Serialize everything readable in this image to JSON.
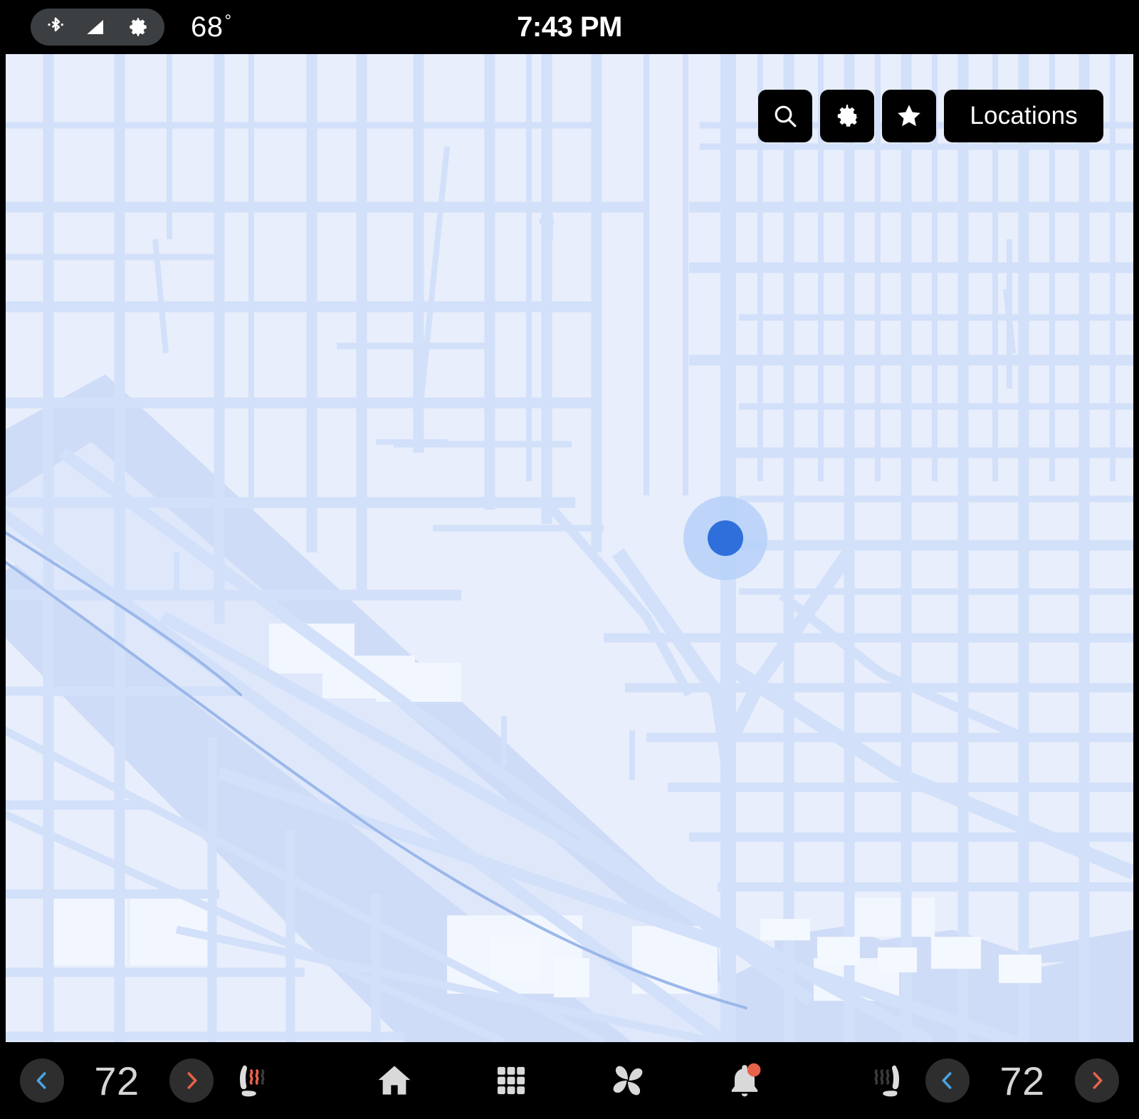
{
  "status_bar": {
    "icons": [
      {
        "name": "bluetooth-icon",
        "label": "Bluetooth"
      },
      {
        "name": "signal-icon",
        "label": "Cellular signal"
      },
      {
        "name": "gear-icon",
        "label": "Settings"
      }
    ],
    "outside_temperature": "68",
    "degree_symbol": "°",
    "clock": "7:43 PM",
    "pill_color": "#3c3f41",
    "text_color": "#ffffff"
  },
  "map": {
    "background_color": "#e8eefb",
    "road_color": "#d2e0fa",
    "water_color": "#cfdcf7",
    "river_line_color": "#9bb8ea",
    "building_color": "#f2f6fe",
    "marker": {
      "name": "current-location-marker",
      "dot_color": "#2f6fdb",
      "halo_color": "#b6d0f8"
    }
  },
  "map_controls": {
    "background_color": "#000000",
    "buttons": [
      {
        "name": "search-button",
        "icon": "search-icon",
        "label": ""
      },
      {
        "name": "settings-button",
        "icon": "gear-icon",
        "label": ""
      },
      {
        "name": "favorites-button",
        "icon": "star-icon",
        "label": ""
      },
      {
        "name": "locations-button",
        "icon": "",
        "label": "Locations"
      }
    ]
  },
  "nav_bar": {
    "background_color": "#000000",
    "climate_left": {
      "decrease_label": "‹",
      "temperature": "72",
      "increase_label": "›",
      "decrease_color": "#4ba3e3",
      "increase_color": "#e8624a",
      "value_color": "#d5d5d5"
    },
    "climate_right": {
      "decrease_label": "‹",
      "temperature": "72",
      "increase_label": "›",
      "decrease_color": "#4ba3e3",
      "increase_color": "#e8624a",
      "value_color": "#d5d5d5"
    },
    "seat_left": {
      "name": "driver-seat-heater-button",
      "icon": "heated-seat-icon",
      "active_waves": 2,
      "total_waves": 3,
      "active_color": "#e8624a",
      "inactive_color": "#3a3a3a",
      "seat_color": "#dcdcdc"
    },
    "seat_right": {
      "name": "passenger-seat-heater-button",
      "icon": "heated-seat-icon",
      "active_waves": 0,
      "total_waves": 3,
      "active_color": "#e8624a",
      "inactive_color": "#3a3a3a",
      "seat_color": "#dcdcdc"
    },
    "center_buttons": [
      {
        "name": "home-button",
        "icon": "home-icon"
      },
      {
        "name": "apps-button",
        "icon": "app-grid-icon"
      },
      {
        "name": "climate-button",
        "icon": "fan-icon"
      },
      {
        "name": "notifications-button",
        "icon": "bell-icon",
        "badge": true,
        "badge_color": "#e8624a"
      }
    ],
    "icon_color": "#d9d9d9"
  }
}
